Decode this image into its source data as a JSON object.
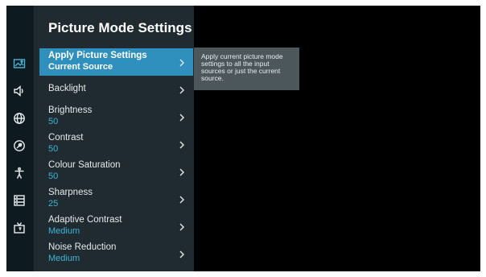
{
  "panel": {
    "title": "Picture Mode Settings"
  },
  "rail": {
    "icons": [
      "picture-icon",
      "sound-icon",
      "network-icon",
      "dashboard-icon",
      "accessibility-icon",
      "system-icon",
      "tv-icon"
    ]
  },
  "menu": {
    "items": [
      {
        "label": "Apply Picture Settings",
        "value": "Current Source",
        "selected": true
      },
      {
        "label": "Backlight",
        "value": ""
      },
      {
        "label": "Brightness",
        "value": "50"
      },
      {
        "label": "Contrast",
        "value": "50"
      },
      {
        "label": "Colour Saturation",
        "value": "50"
      },
      {
        "label": "Sharpness",
        "value": "25"
      },
      {
        "label": "Adaptive Contrast",
        "value": "Medium"
      },
      {
        "label": "Noise Reduction",
        "value": "Medium"
      }
    ]
  },
  "tooltip": {
    "text": "Apply current picture mode settings to all the input sources or just the current source."
  },
  "colors": {
    "accent": "#2f8fbd",
    "value_text": "#3fb5d6",
    "panel_bg": "#1f2b30",
    "rail_bg": "#0d1a1f",
    "tooltip_bg": "#4c575c"
  }
}
